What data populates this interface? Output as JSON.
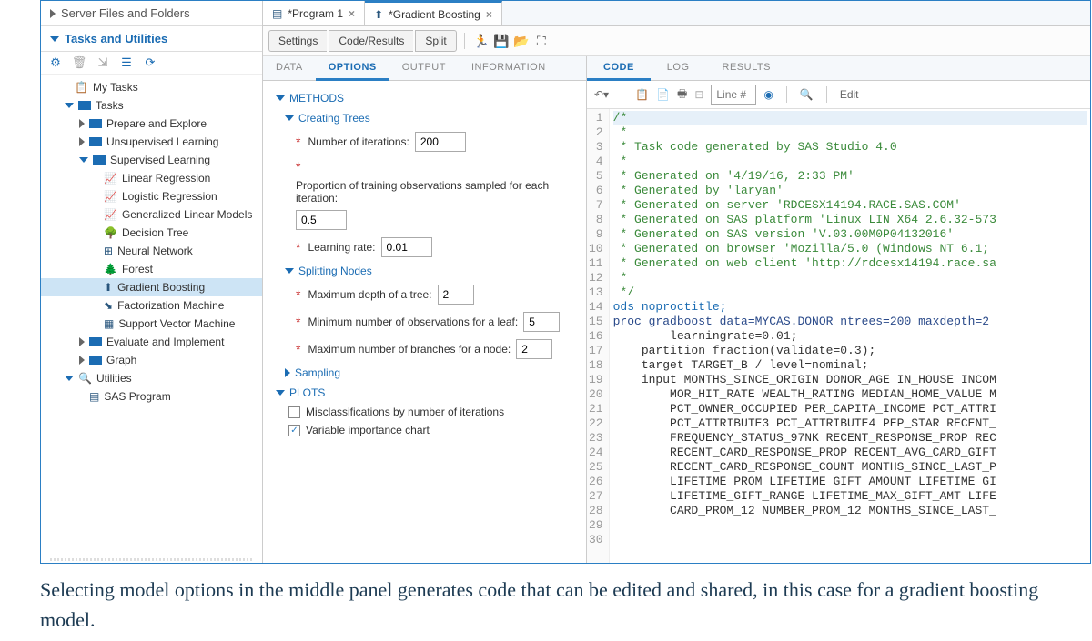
{
  "sidebar": {
    "section1": "Server Files and Folders",
    "section2": "Tasks and Utilities",
    "toolbar_icons": [
      "settings-icon",
      "trash-icon",
      "export-icon",
      "list-icon",
      "refresh-icon"
    ],
    "tree": [
      {
        "label": "My Tasks",
        "icon": "clipboard",
        "indent": 1,
        "exp": ""
      },
      {
        "label": "Tasks",
        "icon": "folder",
        "indent": 1,
        "exp": "down"
      },
      {
        "label": "Prepare and Explore",
        "icon": "folder",
        "indent": 2,
        "exp": "right"
      },
      {
        "label": "Unsupervised Learning",
        "icon": "folder",
        "indent": 2,
        "exp": "right"
      },
      {
        "label": "Supervised Learning",
        "icon": "folder",
        "indent": 2,
        "exp": "down"
      },
      {
        "label": "Linear Regression",
        "icon": "chart",
        "indent": 3,
        "exp": ""
      },
      {
        "label": "Logistic Regression",
        "icon": "chart",
        "indent": 3,
        "exp": ""
      },
      {
        "label": "Generalized Linear Models",
        "icon": "chart",
        "indent": 3,
        "exp": ""
      },
      {
        "label": "Decision Tree",
        "icon": "tree",
        "indent": 3,
        "exp": ""
      },
      {
        "label": "Neural Network",
        "icon": "net",
        "indent": 3,
        "exp": ""
      },
      {
        "label": "Forest",
        "icon": "forest",
        "indent": 3,
        "exp": ""
      },
      {
        "label": "Gradient Boosting",
        "icon": "boost",
        "indent": 3,
        "exp": "",
        "selected": true
      },
      {
        "label": "Factorization Machine",
        "icon": "fact",
        "indent": 3,
        "exp": ""
      },
      {
        "label": "Support Vector Machine",
        "icon": "svm",
        "indent": 3,
        "exp": ""
      },
      {
        "label": "Evaluate and Implement",
        "icon": "folder",
        "indent": 2,
        "exp": "right"
      },
      {
        "label": "Graph",
        "icon": "folder",
        "indent": 2,
        "exp": "right"
      },
      {
        "label": "Utilities",
        "icon": "search",
        "indent": 1,
        "exp": "down"
      },
      {
        "label": "SAS Program",
        "icon": "prog",
        "indent": 2,
        "exp": ""
      }
    ]
  },
  "tabs": [
    {
      "label": "*Program 1",
      "icon": "prog"
    },
    {
      "label": "*Gradient Boosting",
      "icon": "boost",
      "active": true
    }
  ],
  "toolbar": {
    "settings": "Settings",
    "code_results": "Code/Results",
    "split": "Split"
  },
  "opt_tabs": [
    "DATA",
    "OPTIONS",
    "OUTPUT",
    "INFORMATION"
  ],
  "opt_active": 1,
  "options": {
    "methods": "METHODS",
    "creating_trees": "Creating Trees",
    "num_iter_label": "Number of iterations:",
    "num_iter_val": "200",
    "prop_label": "Proportion of training observations sampled for each iteration:",
    "prop_val": "0.5",
    "lr_label": "Learning rate:",
    "lr_val": "0.01",
    "splitting": "Splitting Nodes",
    "maxdepth_label": "Maximum depth of a tree:",
    "maxdepth_val": "2",
    "minobs_label": "Minimum number of observations for a leaf:",
    "minobs_val": "5",
    "maxbranch_label": "Maximum number of branches for a node:",
    "maxbranch_val": "2",
    "sampling": "Sampling",
    "plots": "PLOTS",
    "misclass": "Misclassifications by number of iterations",
    "varimp": "Variable importance chart"
  },
  "code_tabs": [
    "CODE",
    "LOG",
    "RESULTS"
  ],
  "code_active": 0,
  "code_toolbar": {
    "line": "Line #",
    "edit": "Edit"
  },
  "code_lines": [
    {
      "t": "/*",
      "cls": "c-comment c-first"
    },
    {
      "t": " *",
      "cls": "c-comment"
    },
    {
      "t": " * Task code generated by SAS Studio 4.0",
      "cls": "c-comment"
    },
    {
      "t": " *",
      "cls": "c-comment"
    },
    {
      "t": " * Generated on '4/19/16, 2:33 PM'",
      "cls": "c-comment"
    },
    {
      "t": " * Generated by 'laryan'",
      "cls": "c-comment"
    },
    {
      "t": " * Generated on server 'RDCESX14194.RACE.SAS.COM'",
      "cls": "c-comment"
    },
    {
      "t": " * Generated on SAS platform 'Linux LIN X64 2.6.32-573",
      "cls": "c-comment"
    },
    {
      "t": " * Generated on SAS version 'V.03.00M0P04132016'",
      "cls": "c-comment"
    },
    {
      "t": " * Generated on browser 'Mozilla/5.0 (Windows NT 6.1;",
      "cls": "c-comment"
    },
    {
      "t": " * Generated on web client 'http://rdcesx14194.race.sa",
      "cls": "c-comment"
    },
    {
      "t": " *",
      "cls": "c-comment"
    },
    {
      "t": " */",
      "cls": "c-comment"
    },
    {
      "t": "",
      "cls": ""
    },
    {
      "t": "ods noproctitle;",
      "cls": "c-id"
    },
    {
      "t": "",
      "cls": ""
    },
    {
      "t": "proc gradboost data=MYCAS.DONOR ntrees=200 maxdepth=2",
      "cls": "c-kw"
    },
    {
      "t": "        learningrate=0.01;",
      "cls": ""
    },
    {
      "t": "    partition fraction(validate=0.3);",
      "cls": ""
    },
    {
      "t": "    target TARGET_B / level=nominal;",
      "cls": ""
    },
    {
      "t": "    input MONTHS_SINCE_ORIGIN DONOR_AGE IN_HOUSE INCOM",
      "cls": ""
    },
    {
      "t": "        MOR_HIT_RATE WEALTH_RATING MEDIAN_HOME_VALUE M",
      "cls": ""
    },
    {
      "t": "        PCT_OWNER_OCCUPIED PER_CAPITA_INCOME PCT_ATTRI",
      "cls": ""
    },
    {
      "t": "        PCT_ATTRIBUTE3 PCT_ATTRIBUTE4 PEP_STAR RECENT_",
      "cls": ""
    },
    {
      "t": "        FREQUENCY_STATUS_97NK RECENT_RESPONSE_PROP REC",
      "cls": ""
    },
    {
      "t": "        RECENT_CARD_RESPONSE_PROP RECENT_AVG_CARD_GIFT",
      "cls": ""
    },
    {
      "t": "        RECENT_CARD_RESPONSE_COUNT MONTHS_SINCE_LAST_P",
      "cls": ""
    },
    {
      "t": "        LIFETIME_PROM LIFETIME_GIFT_AMOUNT LIFETIME_GI",
      "cls": ""
    },
    {
      "t": "        LIFETIME_GIFT_RANGE LIFETIME_MAX_GIFT_AMT LIFE",
      "cls": ""
    },
    {
      "t": "        CARD_PROM_12 NUMBER_PROM_12 MONTHS_SINCE_LAST_",
      "cls": ""
    }
  ],
  "caption": "Selecting model options in the middle panel generates code that can be edited and shared, in this case for a gradient boosting model."
}
